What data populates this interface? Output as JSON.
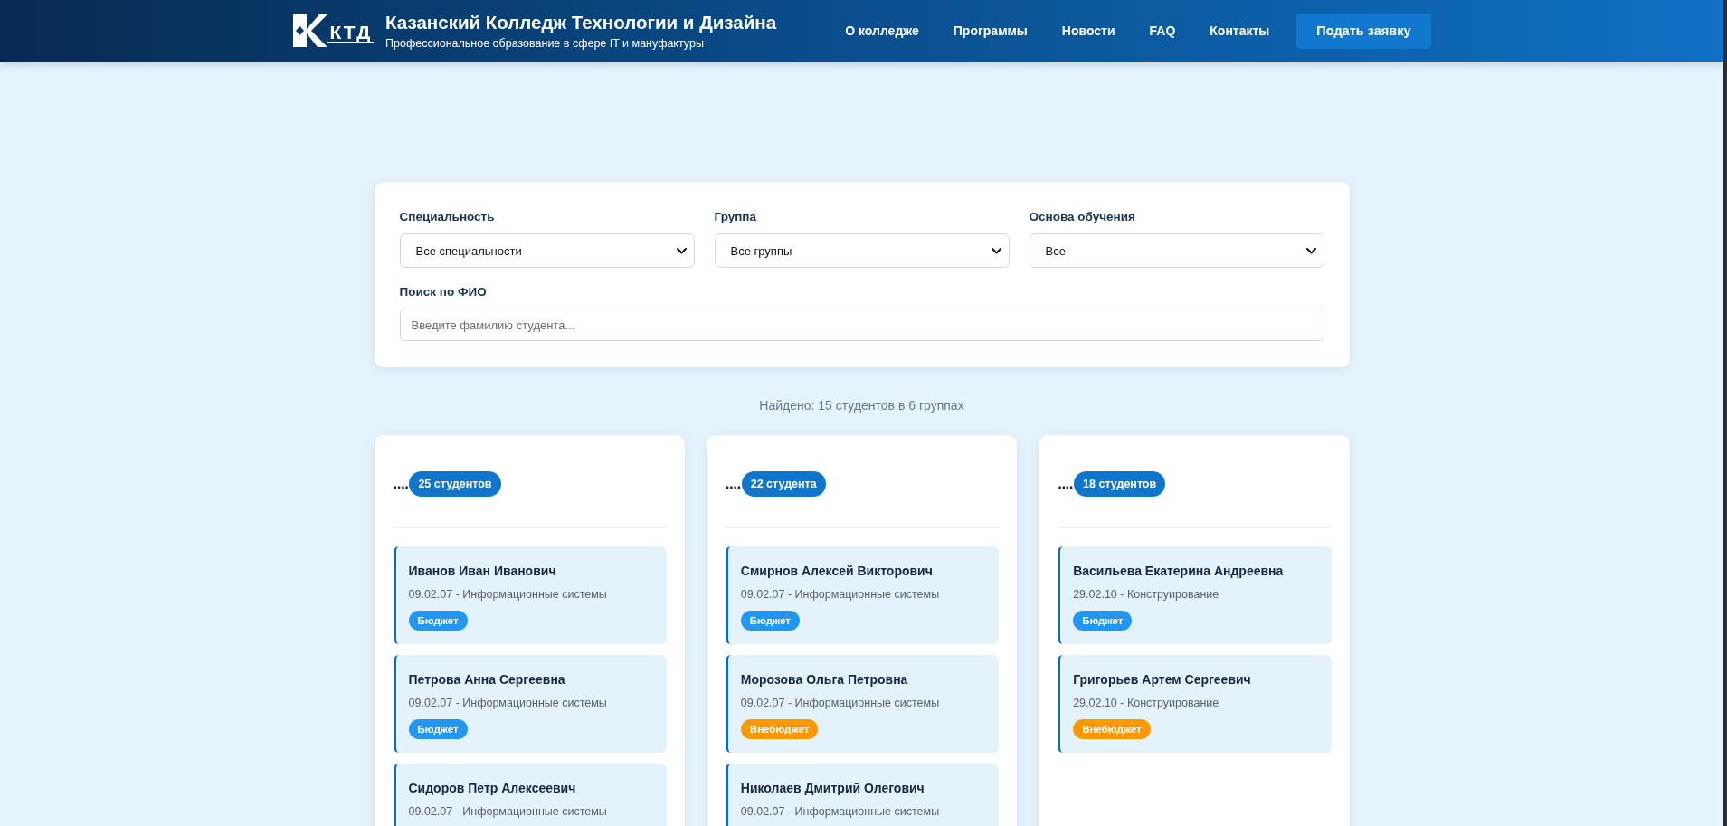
{
  "header": {
    "logo_text": "КТД",
    "title": "Казанский Колледж Технологии и Дизайна",
    "subtitle": "Профессиональное образование в сфере IT и мануфактуры",
    "nav": [
      {
        "label": "О колледже"
      },
      {
        "label": "Программы"
      },
      {
        "label": "Новости"
      },
      {
        "label": "FAQ"
      },
      {
        "label": "Контакты"
      }
    ],
    "cta": "Подать заявку"
  },
  "filters": {
    "selects": [
      {
        "label": "Специальность",
        "value": "Все специальности"
      },
      {
        "label": "Группа",
        "value": "Все группы"
      },
      {
        "label": "Основа обучения",
        "value": "Все"
      }
    ],
    "search": {
      "label": "Поиск по ФИО",
      "placeholder": "Введите фамилию студента..."
    }
  },
  "summary": "Найдено: 15 студентов в 6 группах",
  "groups": [
    {
      "title": "....",
      "count": "25 студентов",
      "students": [
        {
          "name": "Иванов Иван Иванович",
          "program": "09.02.07 - Информационные системы",
          "funding": {
            "kind": "budget",
            "label": "Бюджет"
          }
        },
        {
          "name": "Петрова Анна Сергеевна",
          "program": "09.02.07 - Информационные системы",
          "funding": {
            "kind": "budget",
            "label": "Бюджет"
          }
        },
        {
          "name": "Сидоров Петр Алексеевич",
          "program": "09.02.07 - Информационные системы"
        }
      ]
    },
    {
      "title": "....",
      "count": "22 студента",
      "students": [
        {
          "name": "Смирнов Алексей Викторович",
          "program": "09.02.07 - Информационные системы",
          "funding": {
            "kind": "budget",
            "label": "Бюджет"
          }
        },
        {
          "name": "Морозова Ольга Петровна",
          "program": "09.02.07 - Информационные системы",
          "funding": {
            "kind": "contract",
            "label": "Внебюджет"
          }
        },
        {
          "name": "Николаев Дмитрий Олегович",
          "program": "09.02.07 - Информационные системы"
        }
      ]
    },
    {
      "title": "....",
      "count": "18 студентов",
      "students": [
        {
          "name": "Васильева Екатерина Андреевна",
          "program": "29.02.10 - Конструирование",
          "funding": {
            "kind": "budget",
            "label": "Бюджет"
          }
        },
        {
          "name": "Григорьев Артем Сергеевич",
          "program": "29.02.10 - Конструирование",
          "funding": {
            "kind": "contract",
            "label": "Внебюджет"
          }
        }
      ]
    }
  ]
}
